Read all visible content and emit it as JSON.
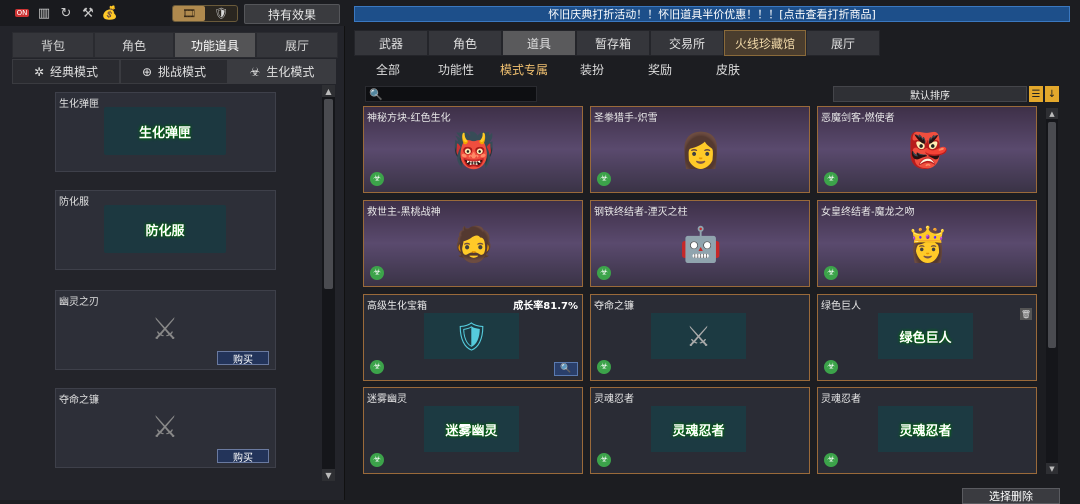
{
  "topbar": {
    "icons": [
      "on-icon",
      "bar-icon",
      "refresh-icon",
      "hammer-icon",
      "sack-icon"
    ],
    "on_label": "ON",
    "toggle": [
      "🎞",
      "🛡"
    ],
    "effect_button": "持有效果"
  },
  "left": {
    "tabs": [
      "背包",
      "角色",
      "功能道具",
      "展厅"
    ],
    "modes": [
      "经典模式",
      "挑战模式",
      "生化模式"
    ],
    "items": [
      {
        "name": "生化弹匣",
        "art": "生化弹匣"
      },
      {
        "name": "防化服",
        "art": "防化服"
      },
      {
        "name": "幽灵之刃",
        "buy": "购买"
      },
      {
        "name": "夺命之镰",
        "buy": "购买"
      }
    ]
  },
  "banner": "怀旧庆典打折活动！！怀旧道具半价优惠！！！[点击查看打折商品]",
  "right": {
    "tabs": [
      "武器",
      "角色",
      "道具",
      "暂存箱",
      "交易所",
      "火线珍藏馆",
      "展厅"
    ],
    "subtabs": [
      "全部",
      "功能性",
      "模式专属",
      "装扮",
      "奖励",
      "皮肤"
    ],
    "sort": "默认排序",
    "cards": [
      {
        "name": "神秘方块-红色生化",
        "icon": "👹"
      },
      {
        "name": "圣拳猎手-炽雪",
        "icon": "👩"
      },
      {
        "name": "恶魔剑客-燃使者",
        "icon": "👺"
      },
      {
        "name": "救世主-黑桃战神",
        "icon": "🧔"
      },
      {
        "name": "钢铁终结者-湮灭之柱",
        "icon": "🤖"
      },
      {
        "name": "女皇终结者-魔龙之吻",
        "icon": "👸"
      },
      {
        "name": "高级生化宝箱",
        "rate": "成长率81.7%",
        "icon": "🛡"
      },
      {
        "name": "夺命之镰",
        "icon": "⚔"
      },
      {
        "name": "绿色巨人",
        "art": "绿色巨人"
      },
      {
        "name": "迷雾幽灵",
        "art": "迷雾幽灵"
      },
      {
        "name": "灵魂忍者",
        "art": "灵魂忍者"
      },
      {
        "name": "灵魂忍者",
        "art": "灵魂忍者"
      }
    ]
  },
  "select_delete": "选择删除"
}
